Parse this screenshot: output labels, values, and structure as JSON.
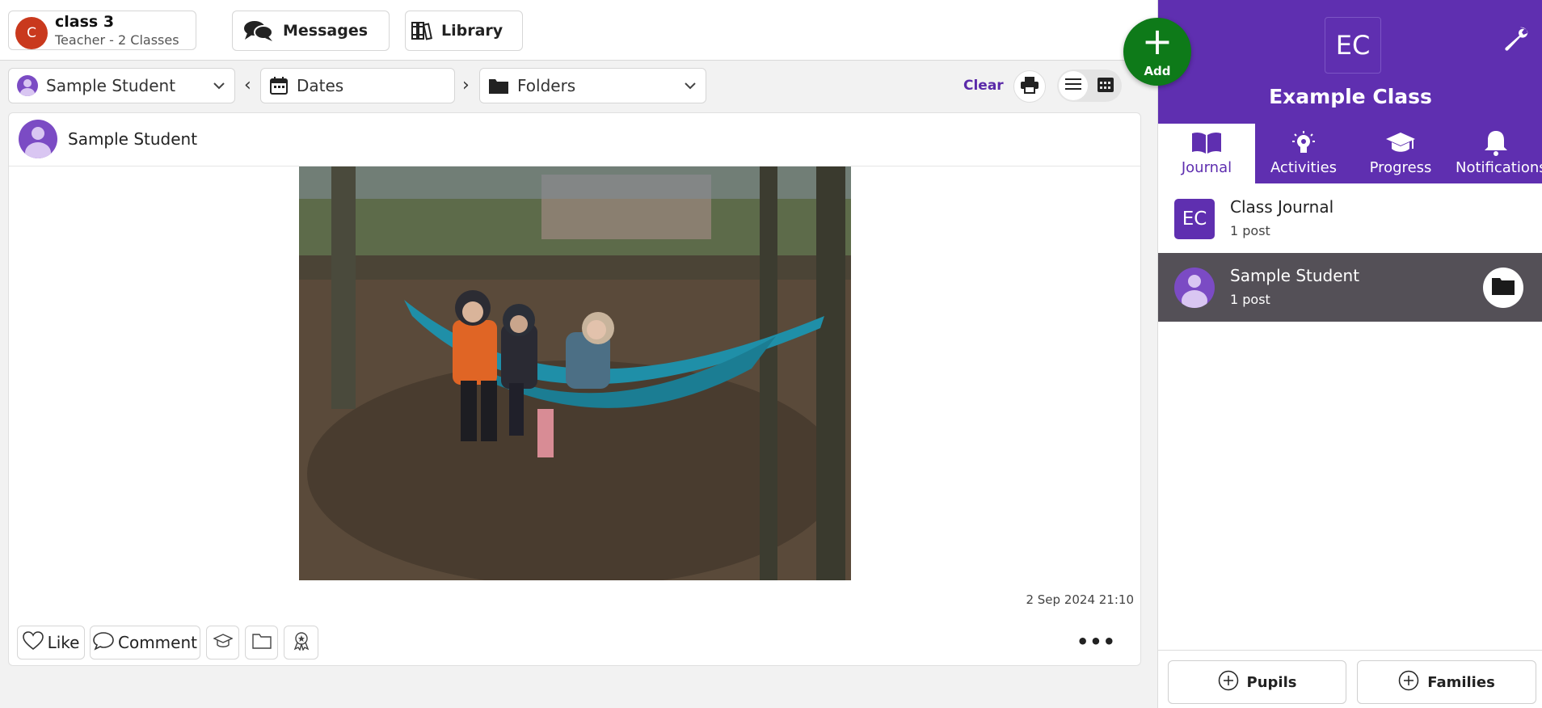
{
  "class_switcher": {
    "avatar_letter": "C",
    "name": "class 3",
    "subtitle": "Teacher - 2 Classes"
  },
  "nav": {
    "messages_label": "Messages",
    "library_label": "Library"
  },
  "filters": {
    "student_label": "Sample Student",
    "dates_label": "Dates",
    "folders_label": "Folders",
    "clear_label": "Clear"
  },
  "post": {
    "author": "Sample Student",
    "timestamp": "2 Sep 2024 21:10",
    "actions": {
      "like_label": "Like",
      "comment_label": "Comment"
    },
    "more_label": "•••"
  },
  "add_button": {
    "label": "Add"
  },
  "right_panel": {
    "badge": "EC",
    "title": "Example Class",
    "tabs": [
      {
        "label": "Journal",
        "icon": "open-book-icon",
        "active": true
      },
      {
        "label": "Activities",
        "icon": "lightbulb-icon"
      },
      {
        "label": "Progress",
        "icon": "graduation-cap-icon"
      },
      {
        "label": "Notifications",
        "icon": "bell-icon"
      }
    ],
    "journals": [
      {
        "badge": "EC",
        "name": "Class Journal",
        "count": "1 post"
      },
      {
        "name": "Sample Student",
        "count": "1 post",
        "selected": true
      }
    ],
    "footer": {
      "pupils_label": "Pupils",
      "families_label": "Families"
    }
  },
  "colors": {
    "brand_purple": "#5f2fb0",
    "add_green": "#0e7a19",
    "selected_row": "#545057",
    "class_avatar": "#c9391d"
  }
}
